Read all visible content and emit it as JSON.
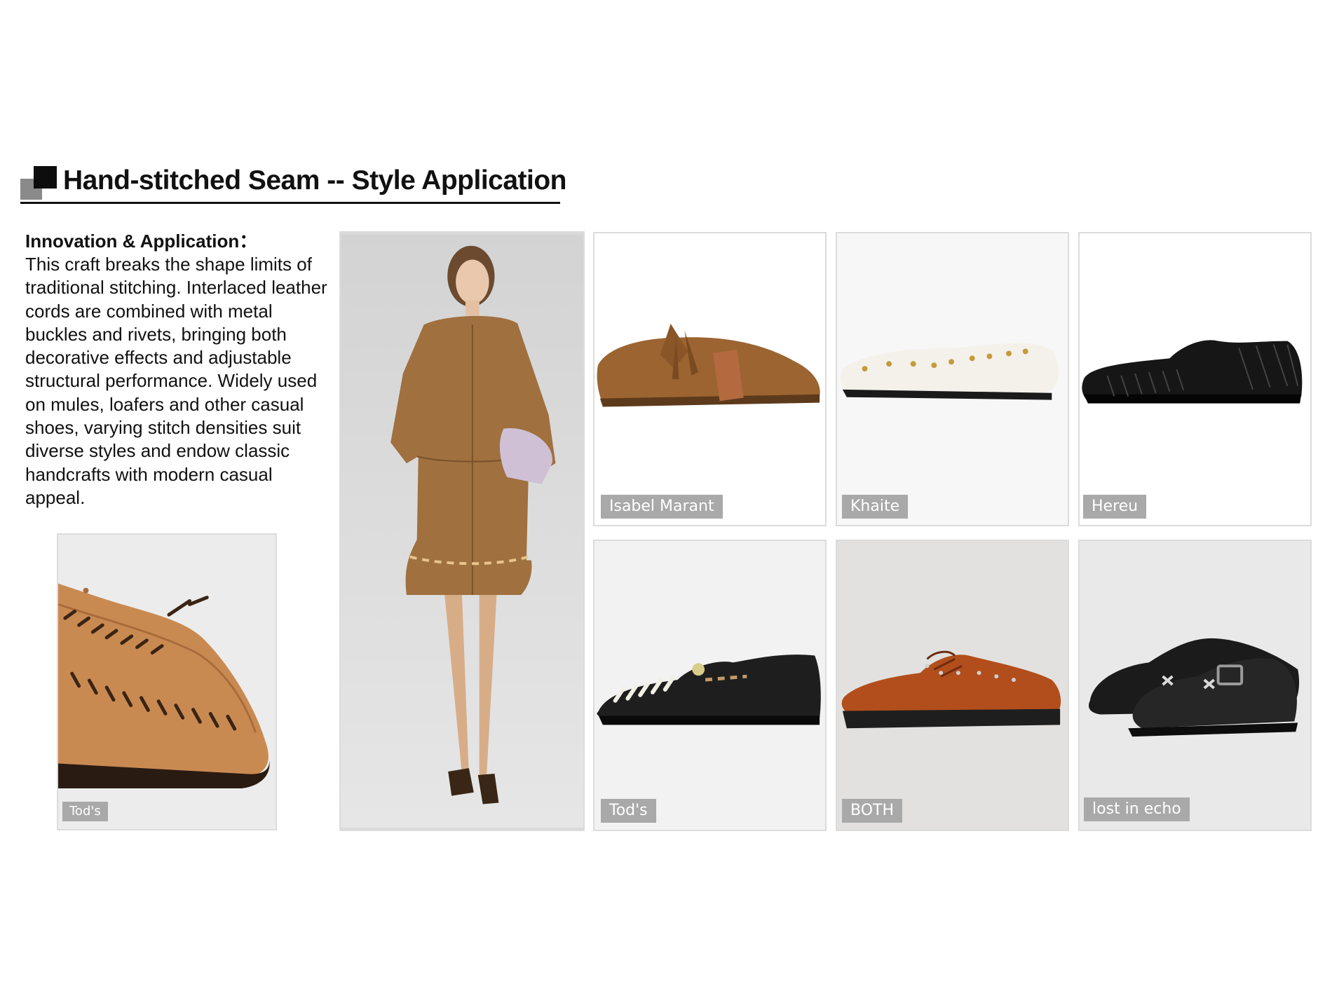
{
  "header": {
    "title": "Hand-stitched Seam -- Style Application"
  },
  "text_panel": {
    "heading": "Innovation & Application：",
    "body": "This craft breaks the shape limits of traditional stitching. Interlaced leather cords are combined with metal buckles and rivets, bringing both decorative effects and adjustable structural performance. Widely used on mules, loafers and other casual shoes, varying stitch densities suit diverse styles and endow classic handcrafts with modern casual appeal."
  },
  "cards": {
    "detail": {
      "brand": "Tod's"
    },
    "model": {
      "brand": ""
    },
    "shoe_1": {
      "brand": "Isabel Marant"
    },
    "shoe_2": {
      "brand": "Khaite"
    },
    "shoe_3": {
      "brand": "Hereu"
    },
    "shoe_4": {
      "brand": "Tod's"
    },
    "shoe_5": {
      "brand": "BOTH"
    },
    "shoe_6": {
      "brand": "lost in echo"
    }
  },
  "colors": {
    "tag_background": "#a9a9a9",
    "tag_text": "#ffffff",
    "title_text": "#111111"
  }
}
